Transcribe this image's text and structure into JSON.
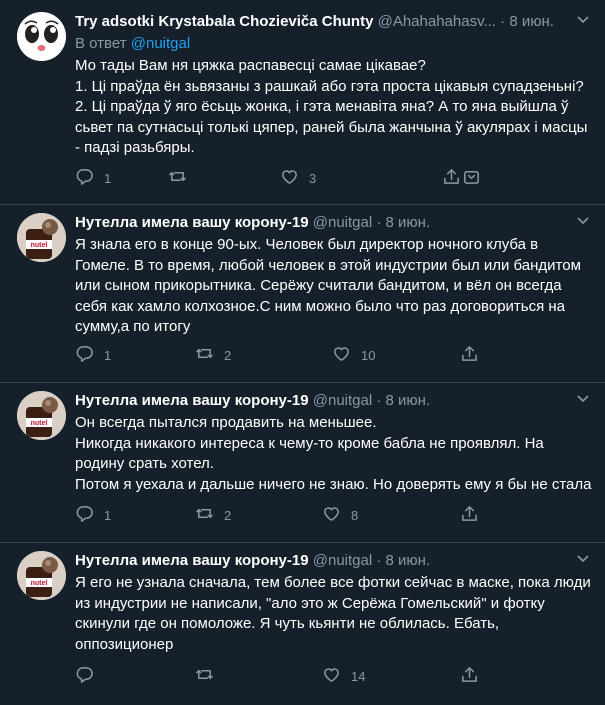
{
  "tweets": [
    {
      "display_name": "Try adsotki Krystabala Chozieviča Chunty",
      "handle": "@Ahahahahasv...",
      "separator": "·",
      "time": "8 июн.",
      "reply_prefix": "В ответ",
      "reply_to": "@nuitgal",
      "lines": [
        "Мо тады Вам ня цяжка распавесці самае цікавае?",
        "1. Ці праўда ён зьвязаны з рашкай або гэта проста цікавыя супадзеньні?",
        "2. Ці праўда ў яго ёсьць жонка, і гэта менавіта яна? А то яна выйшла ў",
        "сьвет па сутнасьці толькі цяпер, раней была жанчына ў акулярах і масцы",
        "- падзі разьбяры."
      ],
      "replies": "1",
      "retweets": "",
      "likes": "3",
      "avatar_bg": "#ffffff"
    },
    {
      "display_name": "Нутелла имела вашу корону-19",
      "handle": "@nuitgal",
      "separator": "·",
      "time": "8 июн.",
      "lines": [
        "Я знала его в конце 90-ых. Человек был директор ночного клуба в",
        "Гомеле. В то время, любой человек в этой индустрии был или бандитом",
        "или сыном прикорытника. Серёжу считали бандитом, и вёл он всегда",
        "себя как хамло колхозное.С ним можно было что раз договориться на",
        "сумму,а по итогу"
      ],
      "replies": "1",
      "retweets": "2",
      "likes": "10",
      "avatar_bg": "#d9cfc4"
    },
    {
      "display_name": "Нутелла имела вашу корону-19",
      "handle": "@nuitgal",
      "separator": "·",
      "time": "8 июн.",
      "lines": [
        "Он всегда пытался продавить на меньшее.",
        "Никогда никакого интереса к чему-то кроме бабла не проявлял. На",
        "родину срать хотел.",
        "Потом я уехала и дальше ничего не знаю. Но доверять ему я бы не стала"
      ],
      "replies": "1",
      "retweets": "2",
      "likes": "8",
      "avatar_bg": "#d9cfc4"
    },
    {
      "display_name": "Нутелла имела вашу корону-19",
      "handle": "@nuitgal",
      "separator": "·",
      "time": "8 июн.",
      "lines": [
        "Я его не узнала сначала, тем более все фотки сейчас в маске, пока люди",
        "из индустрии не написали, \"ало это ж Серёжа Гомельский\" и фотку",
        "скинули где он помоложе.  Я чуть кьянти не облилась. Ебать,",
        "оппозиционер"
      ],
      "replies": "",
      "retweets": "",
      "likes": "14",
      "avatar_bg": "#d9cfc4"
    }
  ],
  "colors": {
    "background": "#15202b",
    "divider": "#38444d",
    "muted_text": "#8899a6",
    "link": "#1da1f2"
  },
  "icons": {
    "more": "chevron-down-icon",
    "reply": "reply-icon",
    "retweet": "retweet-icon",
    "like": "like-icon",
    "share": "share-icon"
  },
  "more_glyph": "⌄"
}
